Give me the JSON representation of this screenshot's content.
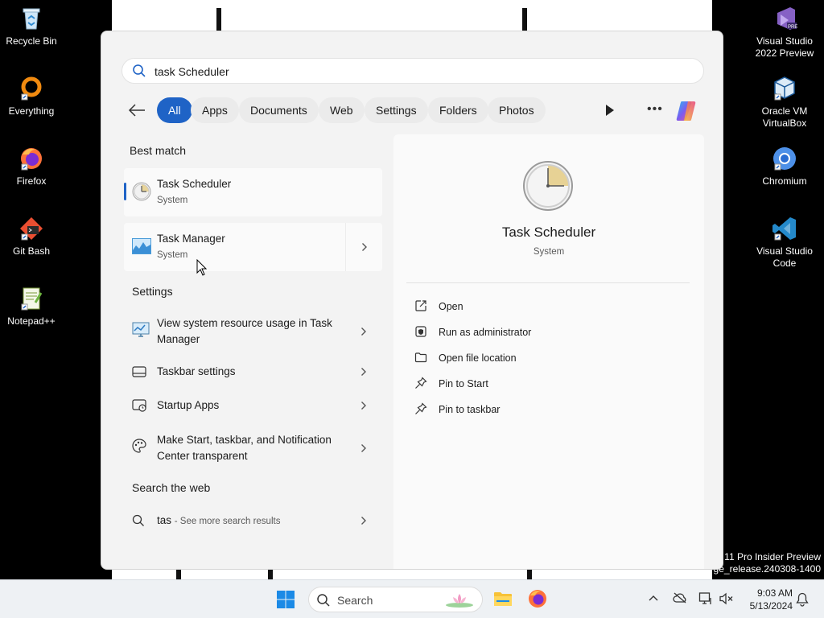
{
  "desktop": {
    "left_icons": [
      {
        "label": "Recycle Bin",
        "icon": "recycle-bin-icon"
      },
      {
        "label": "Everything",
        "icon": "everything-icon"
      },
      {
        "label": "Firefox",
        "icon": "firefox-icon"
      },
      {
        "label": "Git Bash",
        "icon": "git-bash-icon"
      },
      {
        "label": "Notepad++",
        "icon": "notepadpp-icon"
      }
    ],
    "right_icons": [
      {
        "label": "Visual Studio 2022 Preview",
        "icon": "visual-studio-icon"
      },
      {
        "label": "Oracle VM VirtualBox",
        "icon": "virtualbox-icon"
      },
      {
        "label": "Chromium",
        "icon": "chromium-icon"
      },
      {
        "label": "Visual Studio Code",
        "icon": "vscode-icon"
      }
    ],
    "watermark_line1": "11 Pro Insider Preview",
    "watermark_line2": "ge_release.240308-1400"
  },
  "search": {
    "query": "task Scheduler"
  },
  "filters": {
    "chips": [
      "All",
      "Apps",
      "Documents",
      "Web",
      "Settings",
      "Folders",
      "Photos"
    ],
    "active": "All"
  },
  "results": {
    "best_match_title": "Best match",
    "best": [
      {
        "name": "Task Scheduler",
        "sub": "System",
        "icon": "clock-icon"
      },
      {
        "name": "Task Manager",
        "sub": "System",
        "icon": "task-manager-icon"
      }
    ],
    "settings_title": "Settings",
    "settings": [
      {
        "label": "View system resource usage in Task Manager",
        "icon": "monitor-icon"
      },
      {
        "label": "Taskbar settings",
        "icon": "taskbar-icon"
      },
      {
        "label": "Startup Apps",
        "icon": "startup-apps-icon"
      },
      {
        "label": "Make Start, taskbar, and Notification Center transparent",
        "icon": "palette-icon"
      }
    ],
    "web_title": "Search the web",
    "web": {
      "query": "tas",
      "hint": "- See more search results"
    }
  },
  "preview": {
    "title": "Task Scheduler",
    "subtitle": "System",
    "actions": [
      {
        "label": "Open",
        "icon": "open-external-icon"
      },
      {
        "label": "Run as administrator",
        "icon": "shield-icon"
      },
      {
        "label": "Open file location",
        "icon": "folder-icon"
      },
      {
        "label": "Pin to Start",
        "icon": "pin-icon"
      },
      {
        "label": "Pin to taskbar",
        "icon": "pin-icon"
      }
    ]
  },
  "taskbar": {
    "search_label": "Search",
    "time": "9:03 AM",
    "date": "5/13/2024"
  },
  "colors": {
    "accent": "#1f63c6",
    "panel_bg": "#f3f3f3"
  }
}
